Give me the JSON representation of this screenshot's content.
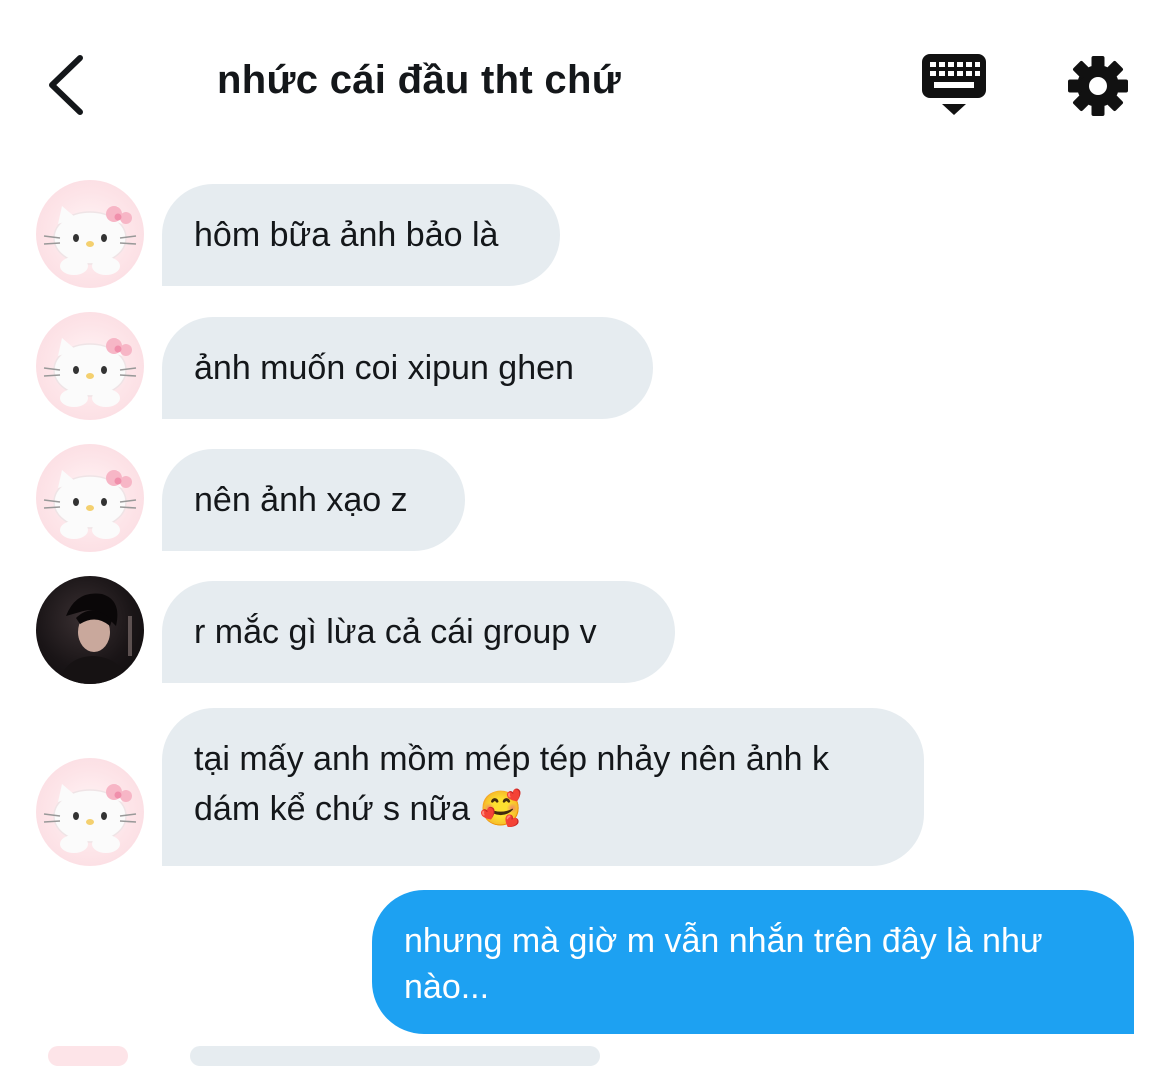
{
  "header": {
    "title": "nhức cái đầu tht chứ",
    "back_icon": "chevron-left-icon",
    "keyboard_icon": "keyboard-dismiss-icon",
    "settings_icon": "gear-icon"
  },
  "messages": [
    {
      "direction": "incoming",
      "avatar": "hello-kitty-avatar",
      "text": "hôm bữa ảnh bảo là"
    },
    {
      "direction": "incoming",
      "avatar": "hello-kitty-avatar",
      "text": "ảnh muốn coi xipun ghen"
    },
    {
      "direction": "incoming",
      "avatar": "hello-kitty-avatar",
      "text": "nên ảnh xạo z"
    },
    {
      "direction": "incoming",
      "avatar": "person-photo-avatar",
      "text": "r mắc gì lừa cả cái group v"
    },
    {
      "direction": "incoming",
      "avatar": "hello-kitty-avatar",
      "lines": [
        "tại mấy anh mồm mép tép nhảy nên ảnh k",
        "dám kể chứ s nữa 🥰"
      ]
    },
    {
      "direction": "outgoing",
      "lines": [
        "nhưng mà giờ m vẫn nhắn trên đây là như",
        "nào..."
      ]
    }
  ],
  "colors": {
    "incoming_bubble": "#e6ecf0",
    "outgoing_bubble": "#1da1f2",
    "text": "#14171a"
  }
}
